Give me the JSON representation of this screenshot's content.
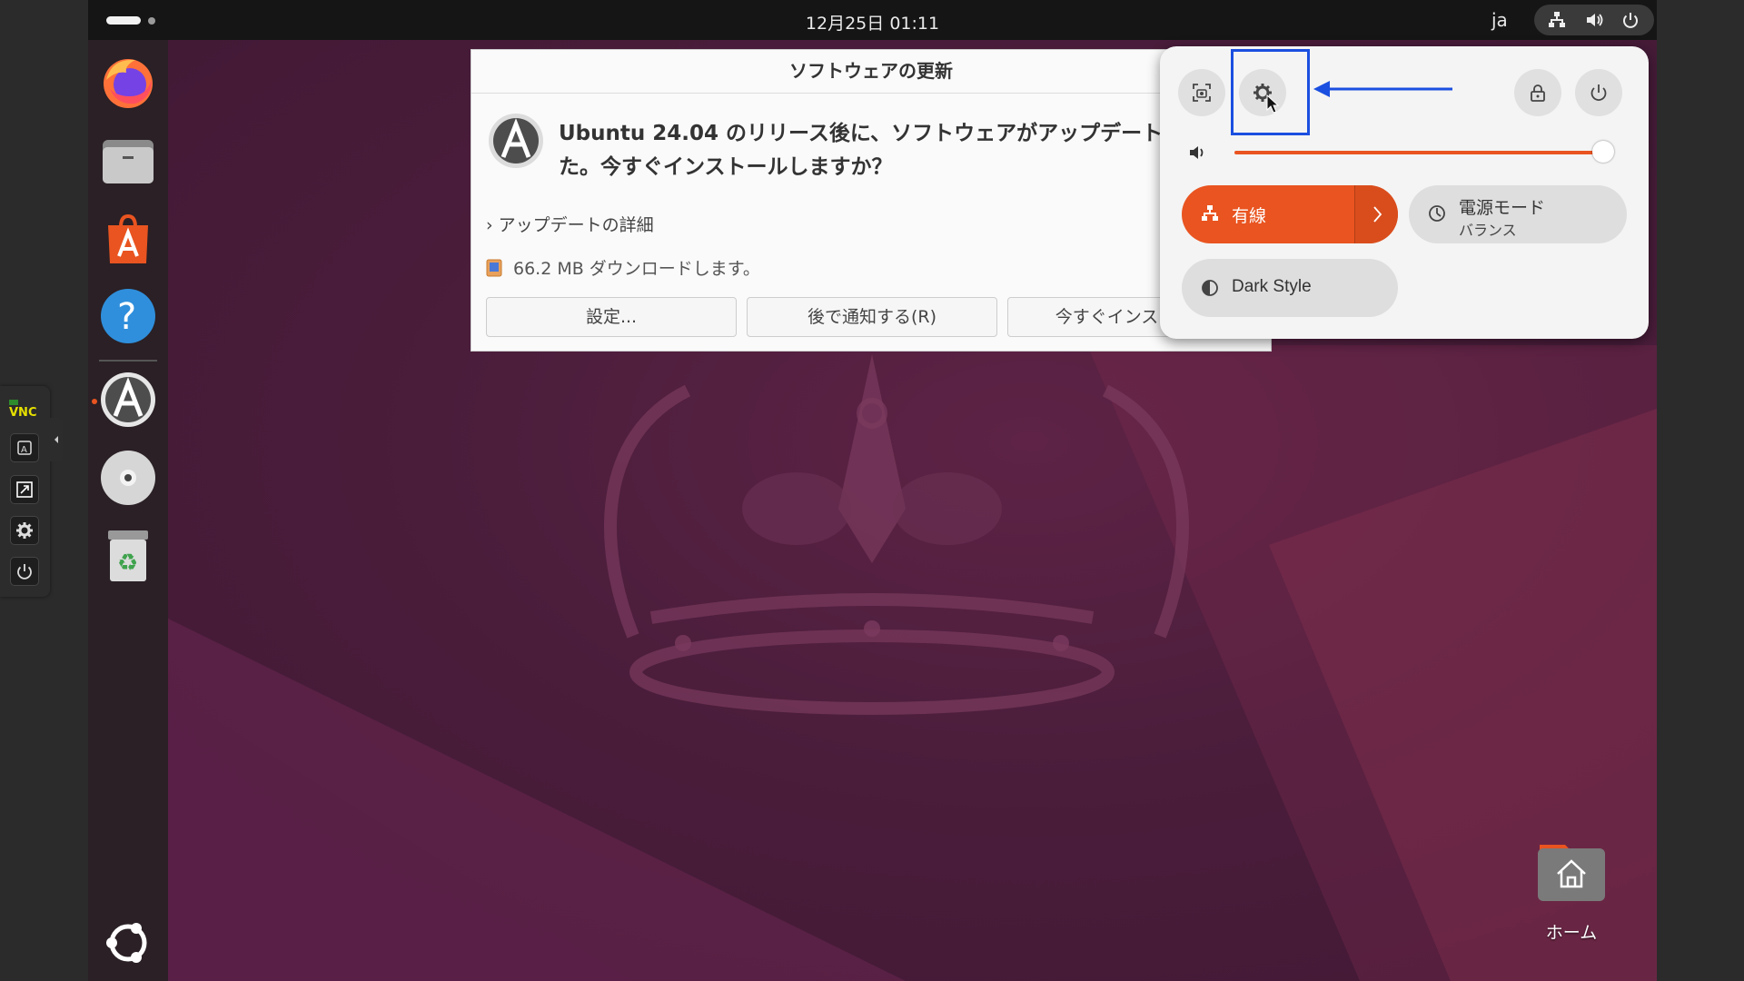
{
  "topbar": {
    "clock": "12月25日 01:11",
    "language": "ja"
  },
  "dock": {
    "apps": [
      "firefox",
      "files",
      "app-center",
      "help",
      "software-updater",
      "optical-disc",
      "trash",
      "show-apps"
    ]
  },
  "dialog": {
    "title": "ソフトウェアの更新",
    "message": "Ubuntu 24.04 のリリース後に、ソフトウェアがアップデートされました。今すぐインストールしますか？",
    "details_toggle": "アップデートの詳細",
    "download_info": "66.2 MB ダウンロードします。",
    "buttons": {
      "settings": "設定...",
      "remind_later": "後で通知する(R)",
      "install_now": "今すぐインストール"
    }
  },
  "quick_settings": {
    "volume_level": 0.98,
    "wired": {
      "label": "有線",
      "active": true
    },
    "power_mode": {
      "title": "電源モード",
      "subtitle": "バランス"
    },
    "dark_style": {
      "label": "Dark Style",
      "active": false
    }
  },
  "desktop": {
    "home_label": "ホーム"
  },
  "colors": {
    "accent": "#e95420",
    "annotation": "#1b4fe0",
    "panel_bg": "#f4f4f4",
    "topbar_bg": "#151515"
  },
  "icons": {
    "screenshot": "screenshot-icon",
    "settings": "settings-gear-icon",
    "lock": "lock-icon",
    "power": "power-icon",
    "volume": "volume-icon",
    "network": "network-wired-icon",
    "power_mode": "power-mode-icon",
    "dark_style": "dark-style-icon"
  }
}
